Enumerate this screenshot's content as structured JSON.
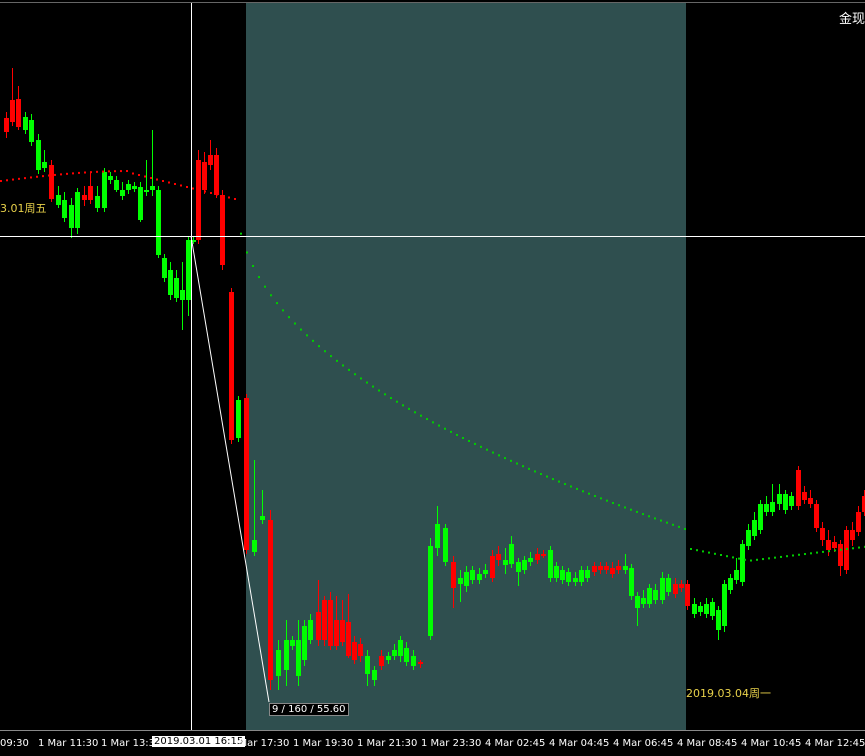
{
  "symbol_label": "金现",
  "day_label_left": "3.01周五",
  "day_label_right": "2019.03.04周一",
  "crosshair_time_tag": "2019.03.01 16:15",
  "ruler_readout": "9 / 160 / 55.60",
  "time_axis": [
    "09:30",
    "1 Mar 11:30",
    "1 Mar 13:30",
    "1 Mar 17:30",
    "1 Mar 19:30",
    "1 Mar 21:30",
    "1 Mar 23:30",
    "4 Mar 02:45",
    "4 Mar 04:45",
    "4 Mar 06:45",
    "4 Mar 08:45",
    "4 Mar 10:45",
    "4 Mar 12:45"
  ],
  "colors": {
    "background": "#000000",
    "session_shade": "#2f4f4f",
    "bull": "#00ff00",
    "bear": "#ff0000",
    "ma_dots": "#00cc00",
    "ma_dots_bear": "#ff0000",
    "crosshair": "#ffffff",
    "date_label": "#e8d14a"
  }
}
